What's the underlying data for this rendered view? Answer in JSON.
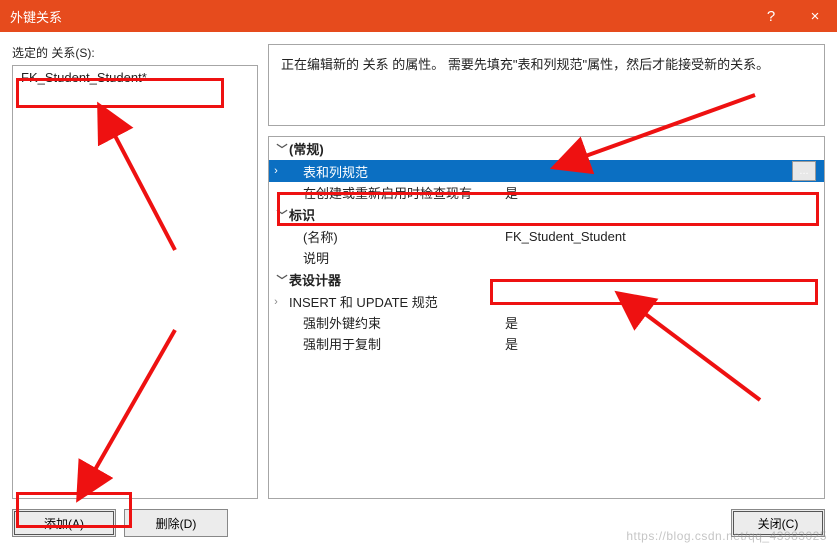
{
  "titlebar": {
    "title": "外键关系",
    "help": "?",
    "close": "×"
  },
  "left": {
    "label": "选定的 关系(S):",
    "item": "FK_Student_Student*",
    "add": "添加(A)",
    "delete": "删除(D)"
  },
  "right": {
    "desc": "正在编辑新的 关系 的属性。  需要先填充\"表和列规范\"属性，然后才能接受新的关系。",
    "sections": {
      "general": "(常规)",
      "tableColSpec": "表和列规范",
      "checkExisting_key": "在创建或重新启用时检查现有",
      "checkExisting_val": "是",
      "ident": "标识",
      "name_key": "(名称)",
      "name_val": "FK_Student_Student",
      "desc_key": "说明",
      "designer": "表设计器",
      "insertUpdate": "INSERT 和 UPDATE 规范",
      "enforceFK_key": "强制外键约束",
      "enforceFK_val": "是",
      "enforceRepl_key": "强制用于复制",
      "enforceRepl_val": "是"
    },
    "ellipsis": "...",
    "close": "关闭(C)"
  },
  "watermark": "https://blog.csdn.net/qq_43983025"
}
